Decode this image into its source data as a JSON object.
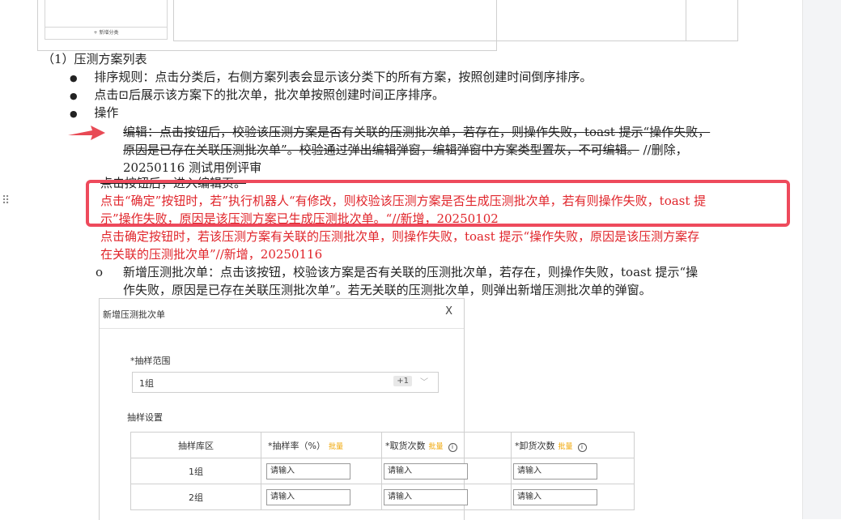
{
  "mockup_top": {
    "add_category": "+ 新增分类"
  },
  "section_title": "（1）压测方案列表",
  "bullets": [
    "排序规则：点击分类后，右侧方案列表会显示该分类下的所有方案，按照创建时间倒序排序。",
    "点击⊡后展示该方案下的批次单，批次单按照创建时间正序排序。",
    "操作"
  ],
  "edit_block": {
    "line1": "编辑：点击按钮后，校验该压测方案是否有关联的压测批次单，若存在，则操作失败，toast 提示“操作失败，",
    "line2_strike": "原因是已存在关联压测批次单”。校验通过弹出编辑弹窗，编辑弹窗中方案类型置灰，不可编辑。",
    "line2_note": " //删除，",
    "line3": "20250116 测试用例评审",
    "line4": "点击按钮后，进入编辑页。"
  },
  "red_text": {
    "line1": "点击“确定”按钮时，若”执行机器人“有修改，则校验该压测方案是否生成压测批次单，若有则操作失败，toast 提",
    "line2": "示”操作失败，原因是该压测方案已生成压测批次单。“//新增，20250102",
    "line3": "点击确定按钮时，若该压测方案有关联的压测批次单，则操作失败，toast 提示“操作失败，原因是该压测方案存",
    "line4": "在关联的压测批次单”//新增，20250116"
  },
  "sub_bullet": {
    "marker": "o",
    "line1": "新增压测批次单：点击该按钮，校验该方案是否有关联的压测批次单，若存在，则操作失败，toast 提示“操",
    "line2": "作失败，原因是已存在关联压测批次单”。若无关联的压测批次单，则弹出新增压测批次单的弹窗。"
  },
  "dialog": {
    "title": "新增压测批次单",
    "close": "X",
    "range_label": "*抽样范围",
    "range_value": "1组",
    "range_more": "+1",
    "settings_label": "抽样设置",
    "columns": [
      "抽样库区",
      "*抽样率（%）",
      "*取货次数",
      "*卸货次数"
    ],
    "batch_tag": "批量",
    "rows": [
      {
        "zone": "1组",
        "placeholder": "请输入"
      },
      {
        "zone": "2组",
        "placeholder": "请输入"
      }
    ]
  },
  "colors": {
    "red": "#e0242a",
    "highlight_box": "#ee4a5c",
    "batch_orange": "#f0a500"
  }
}
